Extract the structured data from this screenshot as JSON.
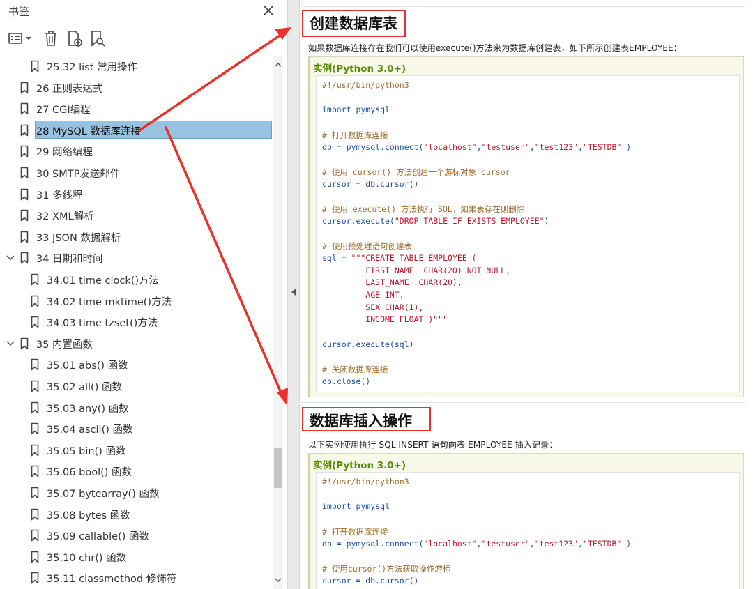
{
  "panel": {
    "title": "书签",
    "icons": {
      "close": "close-icon",
      "options": "list-options-icon",
      "delete": "trash-icon",
      "new": "new-bookmark-icon",
      "find": "find-bookmark-icon"
    }
  },
  "tree": [
    {
      "label": "25.32 list 常用操作",
      "level": 2
    },
    {
      "label": "26 正则表达式",
      "level": 1
    },
    {
      "label": "27 CGI编程",
      "level": 1
    },
    {
      "label": "28 MySQL 数据库连接",
      "level": 1,
      "selected": true
    },
    {
      "label": "29 网络编程",
      "level": 1
    },
    {
      "label": "30 SMTP发送邮件",
      "level": 1
    },
    {
      "label": "31 多线程",
      "level": 1
    },
    {
      "label": "32 XML解析",
      "level": 1
    },
    {
      "label": "33 JSON 数据解析",
      "level": 1
    },
    {
      "label": "34 日期和时间",
      "level": 1,
      "expanded": true
    },
    {
      "label": "34.01 time clock()方法",
      "level": 2
    },
    {
      "label": "34.02 time mktime()方法",
      "level": 2
    },
    {
      "label": "34.03 time tzset()方法",
      "level": 2
    },
    {
      "label": "35 内置函数",
      "level": 1,
      "expanded": true
    },
    {
      "label": "35.01 abs() 函数",
      "level": 2
    },
    {
      "label": "35.02 all() 函数",
      "level": 2
    },
    {
      "label": "35.03 any() 函数",
      "level": 2
    },
    {
      "label": "35.04 ascii() 函数",
      "level": 2
    },
    {
      "label": "35.05 bin() 函数",
      "level": 2
    },
    {
      "label": "35.06 bool() 函数",
      "level": 2
    },
    {
      "label": "35.07 bytearray() 函数",
      "level": 2
    },
    {
      "label": "35.08 bytes 函数",
      "level": 2
    },
    {
      "label": "35.09 callable() 函数",
      "level": 2
    },
    {
      "label": "35.10 chr() 函数",
      "level": 2
    },
    {
      "label": "35.11 classmethod 修饰符",
      "level": 2
    }
  ],
  "doc": {
    "section1": {
      "heading": "创建数据库表",
      "description": "如果数据库连接存在我们可以使用execute()方法来为数据库创建表，如下所示创建表EMPLOYEE：",
      "example_title": "实例(Python 3.0+)",
      "code": [
        [
          [
            "#!/usr/bin/python3",
            "shebang"
          ]
        ],
        [],
        [
          [
            "import pymysql",
            "kw"
          ]
        ],
        [],
        [
          [
            "# 打开数据库连接",
            "cmt"
          ]
        ],
        [
          [
            "db = pymysql.connect(",
            "plain"
          ],
          [
            "\"localhost\"",
            "str"
          ],
          [
            ",",
            "plain"
          ],
          [
            "\"testuser\"",
            "str"
          ],
          [
            ",",
            "plain"
          ],
          [
            "\"test123\"",
            "str"
          ],
          [
            ",",
            "plain"
          ],
          [
            "\"TESTDB\"",
            "str"
          ],
          [
            " )",
            "plain"
          ]
        ],
        [],
        [
          [
            "# 使用 cursor() 方法创建一个游标对象 cursor",
            "cmt"
          ]
        ],
        [
          [
            "cursor = db.cursor()",
            "plain"
          ]
        ],
        [],
        [
          [
            "# 使用 execute() 方法执行 SQL，如果表存在则删除",
            "cmt"
          ]
        ],
        [
          [
            "cursor.execute(",
            "plain"
          ],
          [
            "\"DROP TABLE IF EXISTS EMPLOYEE\"",
            "str"
          ],
          [
            ")",
            "plain"
          ]
        ],
        [],
        [
          [
            "# 使用预处理语句创建表",
            "cmt"
          ]
        ],
        [
          [
            "sql = ",
            "plain"
          ],
          [
            "\"\"\"CREATE TABLE EMPLOYEE (",
            "str"
          ]
        ],
        [
          [
            "         FIRST_NAME  CHAR(20) NOT NULL,",
            "str"
          ]
        ],
        [
          [
            "         LAST_NAME  CHAR(20),",
            "str"
          ]
        ],
        [
          [
            "         AGE INT,",
            "str"
          ]
        ],
        [
          [
            "         SEX CHAR(1),",
            "str"
          ]
        ],
        [
          [
            "         INCOME FLOAT )\"\"\"",
            "str"
          ]
        ],
        [],
        [
          [
            "cursor.execute(sql)",
            "plain"
          ]
        ],
        [],
        [
          [
            "# 关闭数据库连接",
            "cmt"
          ]
        ],
        [
          [
            "db.close()",
            "plain"
          ]
        ]
      ]
    },
    "section2": {
      "heading": "数据库插入操作",
      "description": "以下实例使用执行 SQL INSERT 语句向表 EMPLOYEE 插入记录：",
      "example_title": "实例(Python 3.0+)",
      "code": [
        [
          [
            "#!/usr/bin/python3",
            "shebang"
          ]
        ],
        [],
        [
          [
            "import pymysql",
            "kw"
          ]
        ],
        [],
        [
          [
            "# 打开数据库连接",
            "cmt"
          ]
        ],
        [
          [
            "db = pymysql.connect(",
            "plain"
          ],
          [
            "\"localhost\"",
            "str"
          ],
          [
            ",",
            "plain"
          ],
          [
            "\"testuser\"",
            "str"
          ],
          [
            ",",
            "plain"
          ],
          [
            "\"test123\"",
            "str"
          ],
          [
            ",",
            "plain"
          ],
          [
            "\"TESTDB\"",
            "str"
          ],
          [
            " )",
            "plain"
          ]
        ],
        [],
        [
          [
            "# 使用cursor()方法获取操作游标",
            "cmt"
          ]
        ],
        [
          [
            "cursor = db.cursor()",
            "plain"
          ]
        ]
      ]
    }
  },
  "colors": {
    "accent_red": "#e8322b",
    "selection": "#99c1e0",
    "example_title": "#5c8a0a",
    "code_blue": "#1a4fa8",
    "code_string": "#b5182c",
    "code_comment": "#9c6b2a"
  }
}
